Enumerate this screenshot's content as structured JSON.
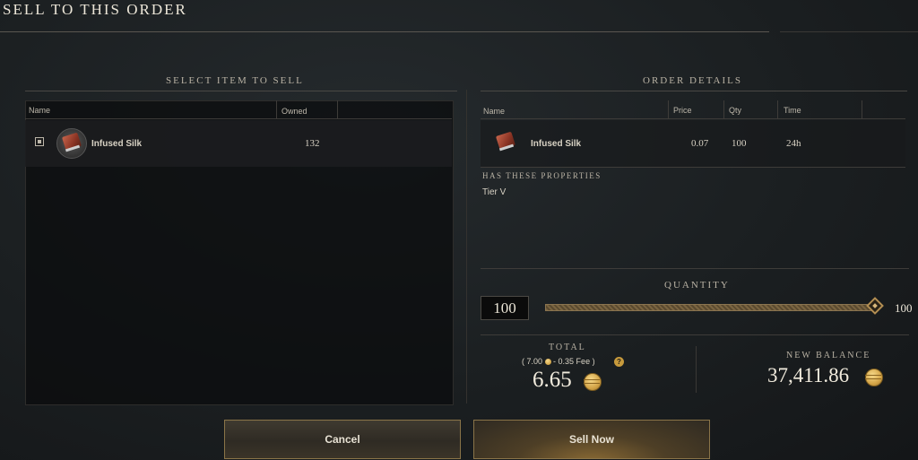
{
  "window": {
    "title": "SELL TO THIS ORDER"
  },
  "left": {
    "section_title": "SELECT ITEM TO SELL",
    "columns": {
      "name": "Name",
      "owned": "Owned"
    },
    "items": [
      {
        "name": "Infused Silk",
        "owned": "132",
        "checked": true,
        "icon": "infused-silk-icon"
      }
    ]
  },
  "right": {
    "section_title": "ORDER DETAILS",
    "columns": {
      "name": "Name",
      "price": "Price",
      "qty": "Qty",
      "time": "Time"
    },
    "order": {
      "name": "Infused Silk",
      "price": "0.07",
      "qty": "100",
      "time": "24h",
      "icon": "infused-silk-icon"
    },
    "properties_title": "HAS THESE PROPERTIES",
    "properties": [
      "Tier V"
    ],
    "quantity": {
      "label": "QUANTITY",
      "value": "100",
      "max_label": "100",
      "slider_fraction": 1.0
    },
    "total": {
      "label": "TOTAL",
      "breakdown_prefix": "( 7.00",
      "breakdown_suffix": "- 0.35 Fee )",
      "help": "?",
      "value": "6.65"
    },
    "balance": {
      "label": "NEW BALANCE",
      "value": "37,411.86"
    }
  },
  "buttons": {
    "cancel": "Cancel",
    "sell": "Sell Now"
  },
  "colors": {
    "accent_gold": "#b38e53",
    "coin": "#d4a548"
  }
}
